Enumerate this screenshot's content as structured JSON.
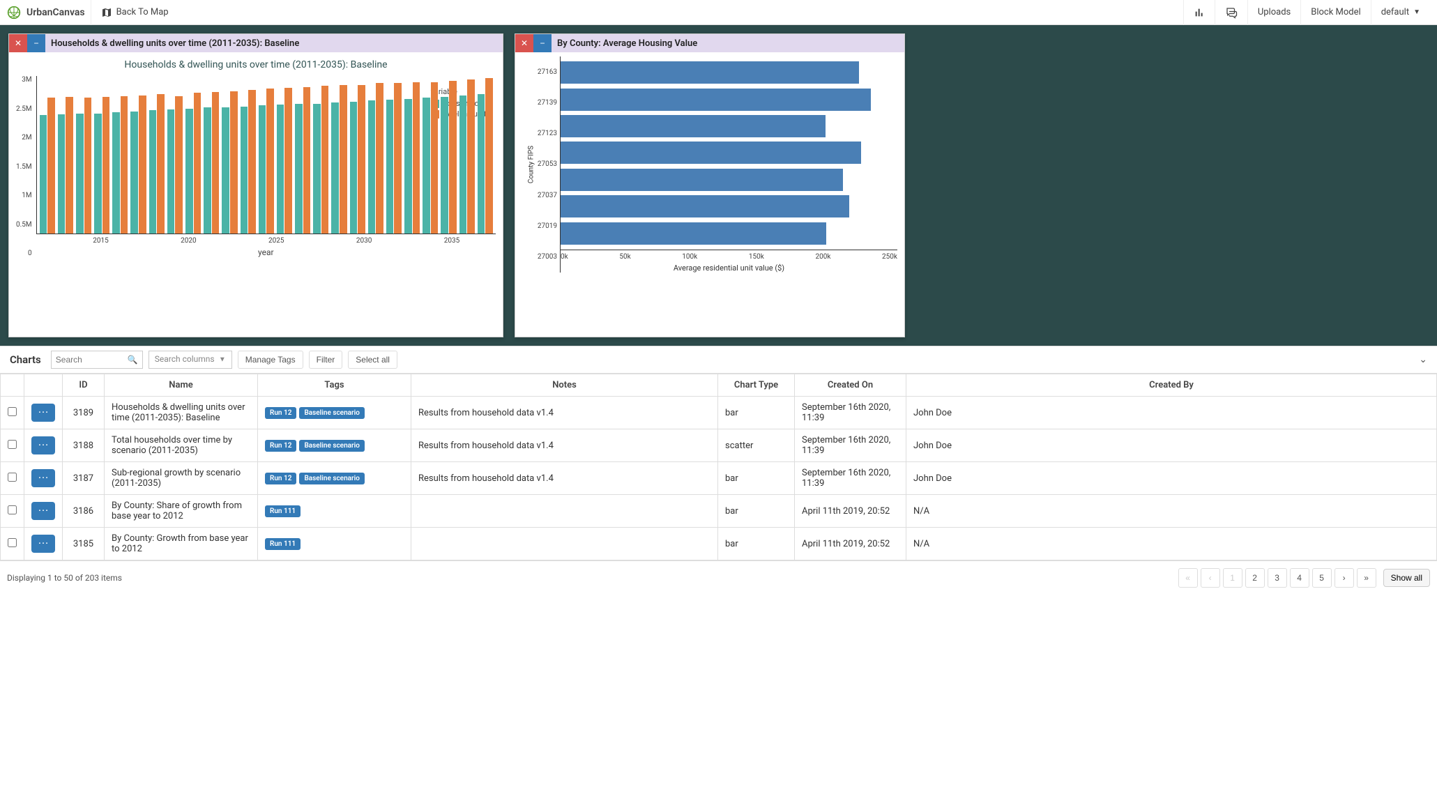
{
  "topbar": {
    "brand": "UrbanCanvas",
    "back": "Back To Map",
    "uploads": "Uploads",
    "block_model": "Block Model",
    "user_dropdown": "default"
  },
  "panels": [
    {
      "title": "Households & dwelling units over time (2011-2035): Baseline"
    },
    {
      "title": "By County: Average Housing Value"
    }
  ],
  "chart_data": [
    {
      "type": "bar",
      "title": "Households & dwelling units over time (2011-2035): Baseline",
      "xlabel": "year",
      "ylabel": "",
      "ylim": [
        0,
        3250000
      ],
      "yticks": [
        "0.5M",
        "1M",
        "1.5M",
        "2M",
        "2.5M",
        "3M"
      ],
      "xticks": [
        "2015",
        "2020",
        "2025",
        "2030",
        "2035"
      ],
      "legend_title": "variable",
      "categories": [
        2011,
        2012,
        2013,
        2014,
        2015,
        2016,
        2017,
        2018,
        2019,
        2020,
        2021,
        2022,
        2023,
        2024,
        2025,
        2026,
        2027,
        2028,
        2029,
        2030,
        2031,
        2032,
        2033,
        2034,
        2035
      ],
      "series": [
        {
          "name": "households",
          "color": "#4bb3a7",
          "values": [
            2450000,
            2460000,
            2470000,
            2480000,
            2500000,
            2520000,
            2540000,
            2560000,
            2580000,
            2600000,
            2610000,
            2620000,
            2640000,
            2660000,
            2670000,
            2680000,
            2700000,
            2720000,
            2740000,
            2760000,
            2780000,
            2800000,
            2820000,
            2850000,
            2880000
          ]
        },
        {
          "name": "dwelling units",
          "color": "#e67e3c",
          "values": [
            2800000,
            2820000,
            2810000,
            2820000,
            2830000,
            2850000,
            2870000,
            2830000,
            2900000,
            2920000,
            2940000,
            2960000,
            2990000,
            3000000,
            3020000,
            3050000,
            3060000,
            3070000,
            3100000,
            3110000,
            3120000,
            3120000,
            3150000,
            3180000,
            3200000
          ]
        }
      ]
    },
    {
      "type": "bar-horizontal",
      "title": "",
      "xlabel": "Average residential unit value ($)",
      "ylabel": "County FIPS",
      "xlim": [
        0,
        280000
      ],
      "xticks": [
        "0k",
        "50k",
        "100k",
        "150k",
        "200k",
        "250k"
      ],
      "categories": [
        "27163",
        "27139",
        "27123",
        "27053",
        "27037",
        "27019",
        "27003"
      ],
      "values": [
        248000,
        258000,
        220000,
        250000,
        235000,
        240000,
        221000
      ],
      "color": "#4a7fb5"
    }
  ],
  "toolbar": {
    "section": "Charts",
    "search_placeholder": "Search",
    "columns_placeholder": "Search columns",
    "manage_tags": "Manage Tags",
    "filter": "Filter",
    "select_all": "Select all"
  },
  "table": {
    "headers": {
      "id": "ID",
      "name": "Name",
      "tags": "Tags",
      "notes": "Notes",
      "type": "Chart Type",
      "created_on": "Created On",
      "created_by": "Created By"
    },
    "rows": [
      {
        "id": "3189",
        "name": "Households & dwelling units over time (2011-2035): Baseline",
        "tags": [
          "Run 12",
          "Baseline scenario"
        ],
        "notes": "Results from household data v1.4",
        "type": "bar",
        "created_on": "September 16th 2020, 11:39",
        "created_by": "John Doe"
      },
      {
        "id": "3188",
        "name": "Total households over time by scenario (2011-2035)",
        "tags": [
          "Run 12",
          "Baseline scenario"
        ],
        "notes": "Results from household data v1.4",
        "type": "scatter",
        "created_on": "September 16th 2020, 11:39",
        "created_by": "John Doe"
      },
      {
        "id": "3187",
        "name": "Sub-regional growth by scenario (2011-2035)",
        "tags": [
          "Run 12",
          "Baseline scenario"
        ],
        "notes": "Results from household data v1.4",
        "type": "bar",
        "created_on": "September 16th 2020, 11:39",
        "created_by": "John Doe"
      },
      {
        "id": "3186",
        "name": "By County: Share of growth from base year to 2012",
        "tags": [
          "Run 111"
        ],
        "notes": "",
        "type": "bar",
        "created_on": "April 11th 2019, 20:52",
        "created_by": "N/A"
      },
      {
        "id": "3185",
        "name": "By County: Growth from base year to 2012",
        "tags": [
          "Run 111"
        ],
        "notes": "",
        "type": "bar",
        "created_on": "April 11th 2019, 20:52",
        "created_by": "N/A"
      }
    ]
  },
  "footer": {
    "status": "Displaying 1 to 50 of 203 items",
    "pages": [
      "1",
      "2",
      "3",
      "4",
      "5"
    ],
    "show_all": "Show all"
  }
}
